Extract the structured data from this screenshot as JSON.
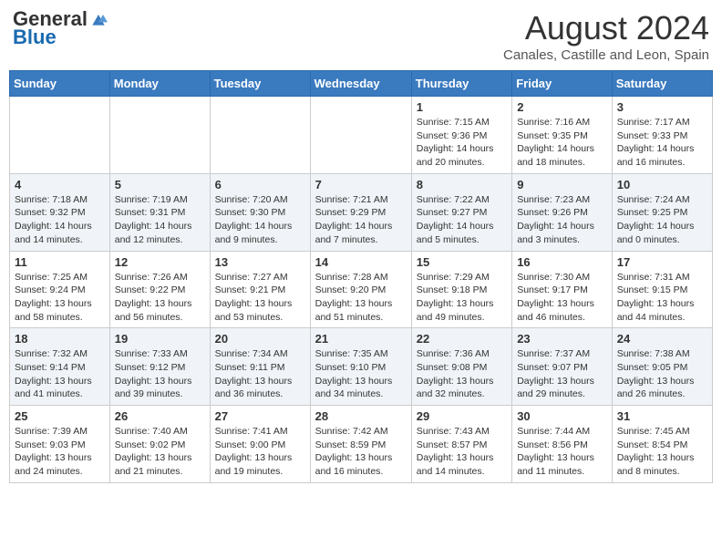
{
  "header": {
    "logo_general": "General",
    "logo_blue": "Blue",
    "month_title": "August 2024",
    "location": "Canales, Castille and Leon, Spain"
  },
  "days_of_week": [
    "Sunday",
    "Monday",
    "Tuesday",
    "Wednesday",
    "Thursday",
    "Friday",
    "Saturday"
  ],
  "weeks": [
    [
      {
        "day": "",
        "info": ""
      },
      {
        "day": "",
        "info": ""
      },
      {
        "day": "",
        "info": ""
      },
      {
        "day": "",
        "info": ""
      },
      {
        "day": "1",
        "info": "Sunrise: 7:15 AM\nSunset: 9:36 PM\nDaylight: 14 hours and 20 minutes."
      },
      {
        "day": "2",
        "info": "Sunrise: 7:16 AM\nSunset: 9:35 PM\nDaylight: 14 hours and 18 minutes."
      },
      {
        "day": "3",
        "info": "Sunrise: 7:17 AM\nSunset: 9:33 PM\nDaylight: 14 hours and 16 minutes."
      }
    ],
    [
      {
        "day": "4",
        "info": "Sunrise: 7:18 AM\nSunset: 9:32 PM\nDaylight: 14 hours and 14 minutes."
      },
      {
        "day": "5",
        "info": "Sunrise: 7:19 AM\nSunset: 9:31 PM\nDaylight: 14 hours and 12 minutes."
      },
      {
        "day": "6",
        "info": "Sunrise: 7:20 AM\nSunset: 9:30 PM\nDaylight: 14 hours and 9 minutes."
      },
      {
        "day": "7",
        "info": "Sunrise: 7:21 AM\nSunset: 9:29 PM\nDaylight: 14 hours and 7 minutes."
      },
      {
        "day": "8",
        "info": "Sunrise: 7:22 AM\nSunset: 9:27 PM\nDaylight: 14 hours and 5 minutes."
      },
      {
        "day": "9",
        "info": "Sunrise: 7:23 AM\nSunset: 9:26 PM\nDaylight: 14 hours and 3 minutes."
      },
      {
        "day": "10",
        "info": "Sunrise: 7:24 AM\nSunset: 9:25 PM\nDaylight: 14 hours and 0 minutes."
      }
    ],
    [
      {
        "day": "11",
        "info": "Sunrise: 7:25 AM\nSunset: 9:24 PM\nDaylight: 13 hours and 58 minutes."
      },
      {
        "day": "12",
        "info": "Sunrise: 7:26 AM\nSunset: 9:22 PM\nDaylight: 13 hours and 56 minutes."
      },
      {
        "day": "13",
        "info": "Sunrise: 7:27 AM\nSunset: 9:21 PM\nDaylight: 13 hours and 53 minutes."
      },
      {
        "day": "14",
        "info": "Sunrise: 7:28 AM\nSunset: 9:20 PM\nDaylight: 13 hours and 51 minutes."
      },
      {
        "day": "15",
        "info": "Sunrise: 7:29 AM\nSunset: 9:18 PM\nDaylight: 13 hours and 49 minutes."
      },
      {
        "day": "16",
        "info": "Sunrise: 7:30 AM\nSunset: 9:17 PM\nDaylight: 13 hours and 46 minutes."
      },
      {
        "day": "17",
        "info": "Sunrise: 7:31 AM\nSunset: 9:15 PM\nDaylight: 13 hours and 44 minutes."
      }
    ],
    [
      {
        "day": "18",
        "info": "Sunrise: 7:32 AM\nSunset: 9:14 PM\nDaylight: 13 hours and 41 minutes."
      },
      {
        "day": "19",
        "info": "Sunrise: 7:33 AM\nSunset: 9:12 PM\nDaylight: 13 hours and 39 minutes."
      },
      {
        "day": "20",
        "info": "Sunrise: 7:34 AM\nSunset: 9:11 PM\nDaylight: 13 hours and 36 minutes."
      },
      {
        "day": "21",
        "info": "Sunrise: 7:35 AM\nSunset: 9:10 PM\nDaylight: 13 hours and 34 minutes."
      },
      {
        "day": "22",
        "info": "Sunrise: 7:36 AM\nSunset: 9:08 PM\nDaylight: 13 hours and 32 minutes."
      },
      {
        "day": "23",
        "info": "Sunrise: 7:37 AM\nSunset: 9:07 PM\nDaylight: 13 hours and 29 minutes."
      },
      {
        "day": "24",
        "info": "Sunrise: 7:38 AM\nSunset: 9:05 PM\nDaylight: 13 hours and 26 minutes."
      }
    ],
    [
      {
        "day": "25",
        "info": "Sunrise: 7:39 AM\nSunset: 9:03 PM\nDaylight: 13 hours and 24 minutes."
      },
      {
        "day": "26",
        "info": "Sunrise: 7:40 AM\nSunset: 9:02 PM\nDaylight: 13 hours and 21 minutes."
      },
      {
        "day": "27",
        "info": "Sunrise: 7:41 AM\nSunset: 9:00 PM\nDaylight: 13 hours and 19 minutes."
      },
      {
        "day": "28",
        "info": "Sunrise: 7:42 AM\nSunset: 8:59 PM\nDaylight: 13 hours and 16 minutes."
      },
      {
        "day": "29",
        "info": "Sunrise: 7:43 AM\nSunset: 8:57 PM\nDaylight: 13 hours and 14 minutes."
      },
      {
        "day": "30",
        "info": "Sunrise: 7:44 AM\nSunset: 8:56 PM\nDaylight: 13 hours and 11 minutes."
      },
      {
        "day": "31",
        "info": "Sunrise: 7:45 AM\nSunset: 8:54 PM\nDaylight: 13 hours and 8 minutes."
      }
    ]
  ]
}
